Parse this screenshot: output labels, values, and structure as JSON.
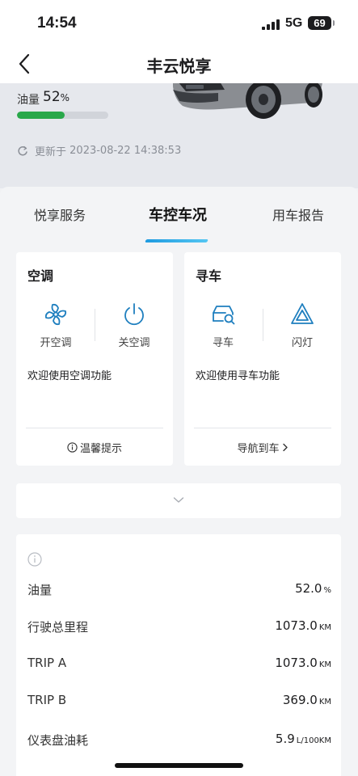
{
  "status_bar": {
    "time": "14:54",
    "network": "5G",
    "battery": "69"
  },
  "header": {
    "title": "丰云悦享"
  },
  "vehicle": {
    "fuel_label": "油量",
    "fuel_percent": "52",
    "fuel_percent_unit": "%",
    "fuel_fraction": 0.52,
    "update_prefix": "更新于",
    "update_time": "2023-08-22 14:38:53"
  },
  "tabs": [
    {
      "label": "悦享服务",
      "active": false
    },
    {
      "label": "车控车况",
      "active": true
    },
    {
      "label": "用车报告",
      "active": false
    }
  ],
  "cards": {
    "ac": {
      "title": "空调",
      "buttons": [
        {
          "label": "开空调",
          "icon": "fan-icon"
        },
        {
          "label": "关空调",
          "icon": "power-icon"
        }
      ],
      "message": "欢迎使用空调功能",
      "footer": "温馨提示",
      "footer_icon": "info-icon"
    },
    "find_car": {
      "title": "寻车",
      "buttons": [
        {
          "label": "寻车",
          "icon": "car-search-icon"
        },
        {
          "label": "闪灯",
          "icon": "hazard-icon"
        }
      ],
      "message": "欢迎使用寻车功能",
      "footer": "导航到车",
      "footer_icon": "chevron-right-icon"
    }
  },
  "expand_icon": "chevron-down-icon",
  "stats": [
    {
      "label": "油量",
      "value": "52.0",
      "unit": "%"
    },
    {
      "label": "行驶总里程",
      "value": "1073.0",
      "unit": "KM"
    },
    {
      "label": "TRIP A",
      "value": "1073.0",
      "unit": "KM"
    },
    {
      "label": "TRIP B",
      "value": "369.0",
      "unit": "KM"
    },
    {
      "label": "仪表盘油耗",
      "value": "5.9",
      "unit": "L/100KM"
    }
  ],
  "colors": {
    "fuel_bar": "#29a84a",
    "accent": "#1f7fbf",
    "tab_underline": "#1f9be0"
  }
}
